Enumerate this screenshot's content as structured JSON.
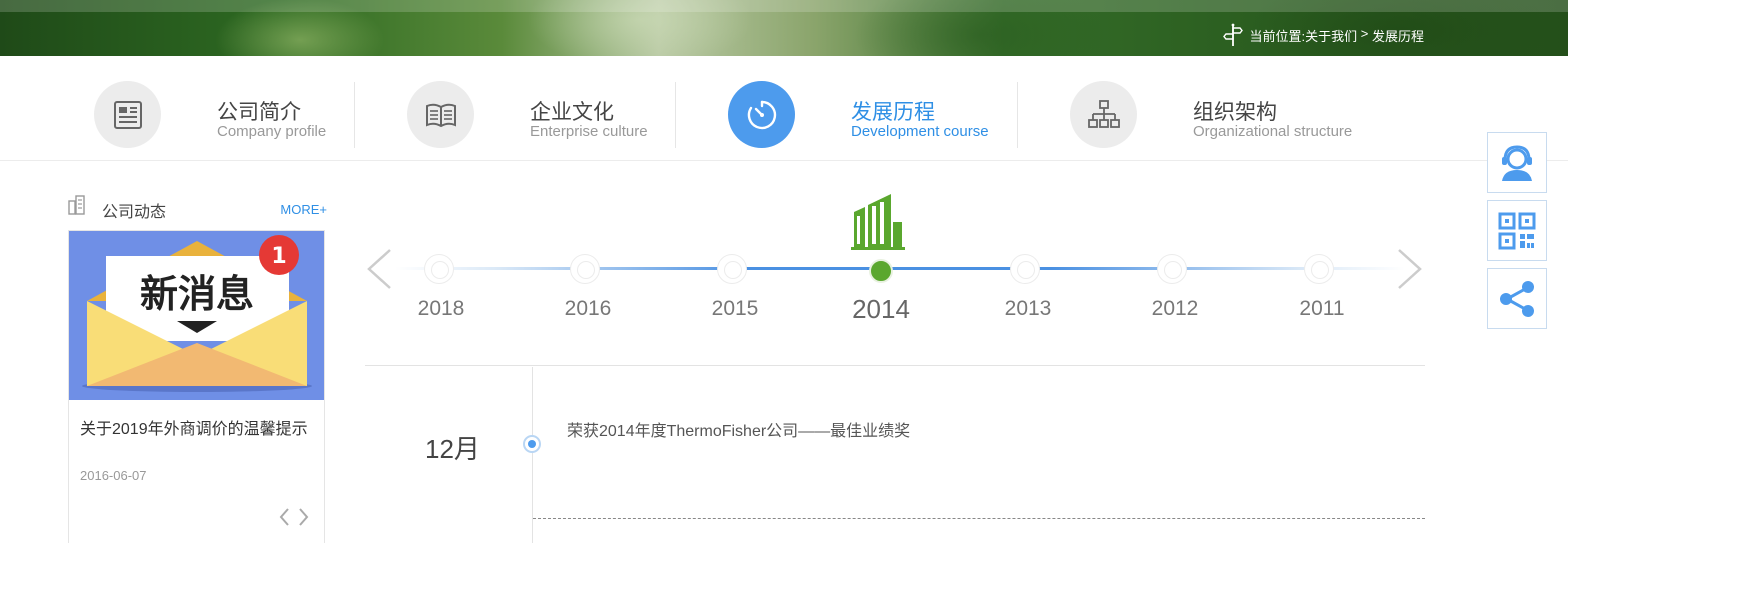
{
  "breadcrumb": {
    "label": "当前位置:",
    "items": [
      "关于我们",
      "发展历程"
    ],
    "separator": " > "
  },
  "tabs": [
    {
      "zh": "公司简介",
      "en": "Company profile",
      "icon": "profile-doc-icon",
      "active": false
    },
    {
      "zh": "企业文化",
      "en": "Enterprise culture",
      "icon": "open-book-icon",
      "active": false
    },
    {
      "zh": "发展历程",
      "en": "Development course",
      "icon": "clock-icon",
      "active": true
    },
    {
      "zh": "组织架构",
      "en": "Organizational structure",
      "icon": "org-chart-icon",
      "active": false
    }
  ],
  "sidebar": {
    "title": "公司动态",
    "more": "MORE+",
    "news": {
      "image_text": "新消息",
      "badge": "1",
      "title": "关于2019年外商调价的温馨提示",
      "date": "2016-06-07"
    }
  },
  "timeline": {
    "years": [
      "2018",
      "2016",
      "2015",
      "2014",
      "2013",
      "2012",
      "2011"
    ],
    "active_year": "2014",
    "events": [
      {
        "month": "12月",
        "text": "荣获2014年度ThermoFisher公司——最佳业绩奖"
      }
    ]
  },
  "floating_buttons": [
    "customer-service-icon",
    "qr-code-icon",
    "share-icon"
  ],
  "colors": {
    "accent_blue": "#4d9bed",
    "link_blue": "#2f8fe5",
    "active_green": "#5aa72e",
    "inactive_circle": "#ececec"
  }
}
